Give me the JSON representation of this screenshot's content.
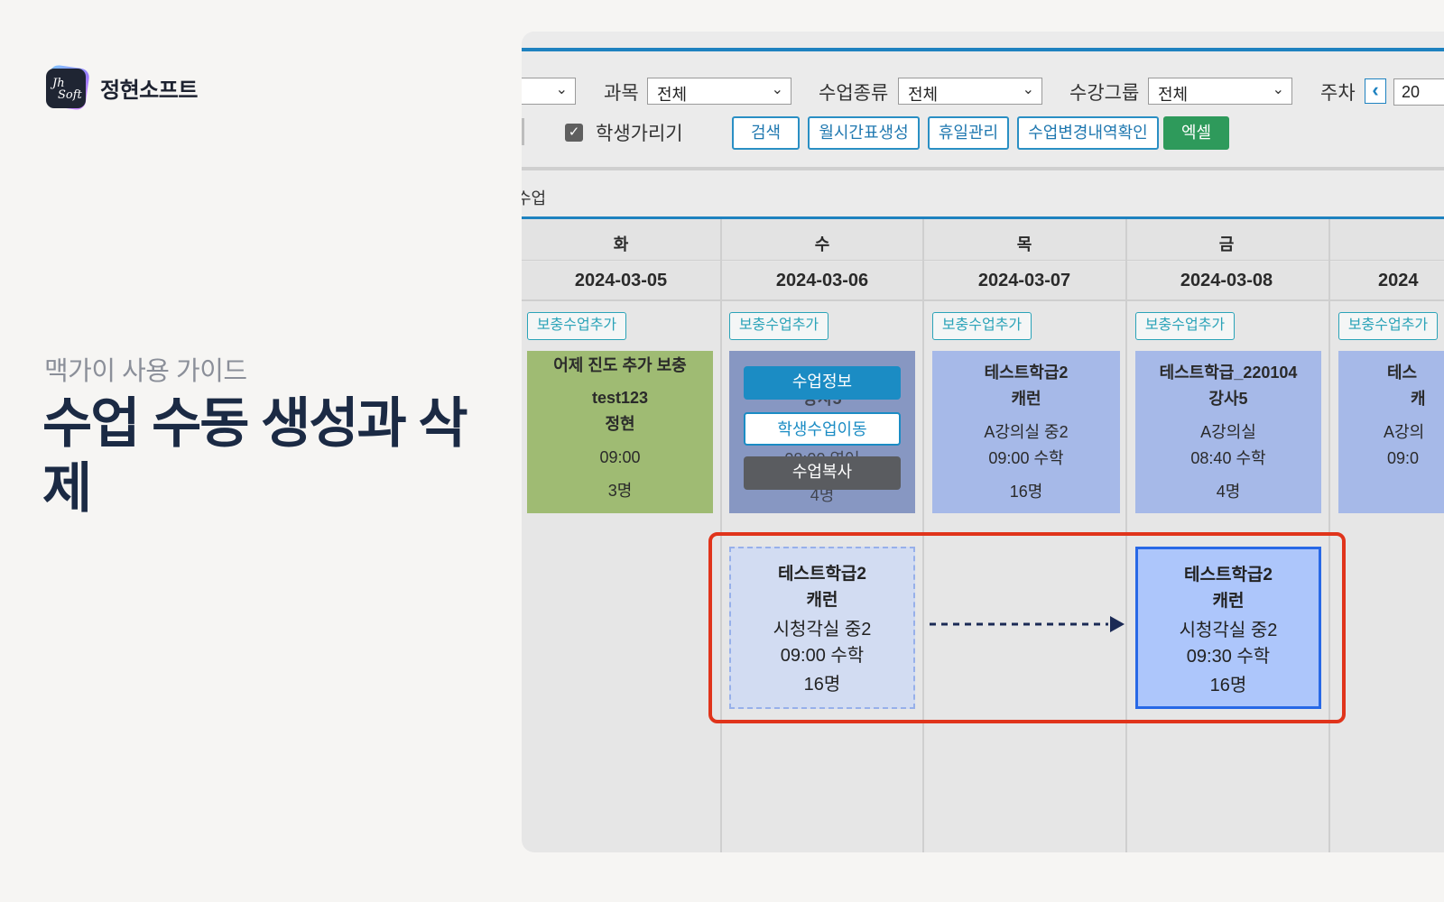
{
  "brand": {
    "logo_text_1": "Jh",
    "logo_text_2": "Soft",
    "name": "정현소프트"
  },
  "guide": {
    "subtitle": "맥가이 사용 가이드",
    "title": "수업 수동 생성과 삭제"
  },
  "filters": {
    "subject_label": "과목",
    "subject_value": "전체",
    "class_type_label": "수업종류",
    "class_type_value": "전체",
    "group_label": "수강그룹",
    "group_value": "전체",
    "week_label": "주차",
    "week_value": "20",
    "hide_students_label": "학생가리기",
    "hide_students_checked": true
  },
  "actions": {
    "search": "검색",
    "monthly_timetable": "월시간표생성",
    "holiday_mgmt": "휴일관리",
    "change_history": "수업변경내역확인",
    "excel": "엑셀"
  },
  "section_label": "수업",
  "days": [
    {
      "dow": "화",
      "date": "2024-03-05",
      "add_label": "보충수업추가"
    },
    {
      "dow": "수",
      "date": "2024-03-06",
      "add_label": "보충수업추가"
    },
    {
      "dow": "목",
      "date": "2024-03-07",
      "add_label": "보충수업추가"
    },
    {
      "dow": "금",
      "date": "2024-03-08",
      "add_label": "보충수업추가"
    },
    {
      "dow": "",
      "date": "2024",
      "add_label": "보충수업추가"
    }
  ],
  "cards": {
    "tue": {
      "title": "어제 진도 추가 보충",
      "line1": "test123",
      "line2": "정현",
      "time": "09:00",
      "count": "3명"
    },
    "wed_ghost": {
      "line1": "강사5",
      "line2": "08:00 영어",
      "count": "4명"
    },
    "thu": {
      "title": "테스트학급2",
      "teacher": "캐런",
      "room_grade": "A강의실   중2",
      "time_subject": "09:00   수학",
      "count": "16명"
    },
    "fri": {
      "title": "테스트학급_220104",
      "teacher": "강사5",
      "room_grade": "A강의실",
      "time_subject": "08:40   수학",
      "count": "4명"
    },
    "sat": {
      "title": "테스",
      "teacher": "캐",
      "room_grade": "A강의",
      "time_subject": "09:0"
    }
  },
  "context_menu": {
    "info": "수업정보",
    "move": "학생수업이동",
    "copy": "수업복사"
  },
  "move_demo": {
    "source": {
      "title": "테스트학급2",
      "teacher": "캐런",
      "room_grade": "시청각실   중2",
      "time_subject": "09:00   수학",
      "count": "16명"
    },
    "target": {
      "title": "테스트학급2",
      "teacher": "캐런",
      "room_grade": "시청각실   중2",
      "time_subject": "09:30   수학",
      "count": "16명"
    }
  },
  "colors": {
    "accent": "#1e82c0",
    "excel": "#2e9a5b",
    "highlight": "#e0341b",
    "target_border": "#2868e6"
  }
}
